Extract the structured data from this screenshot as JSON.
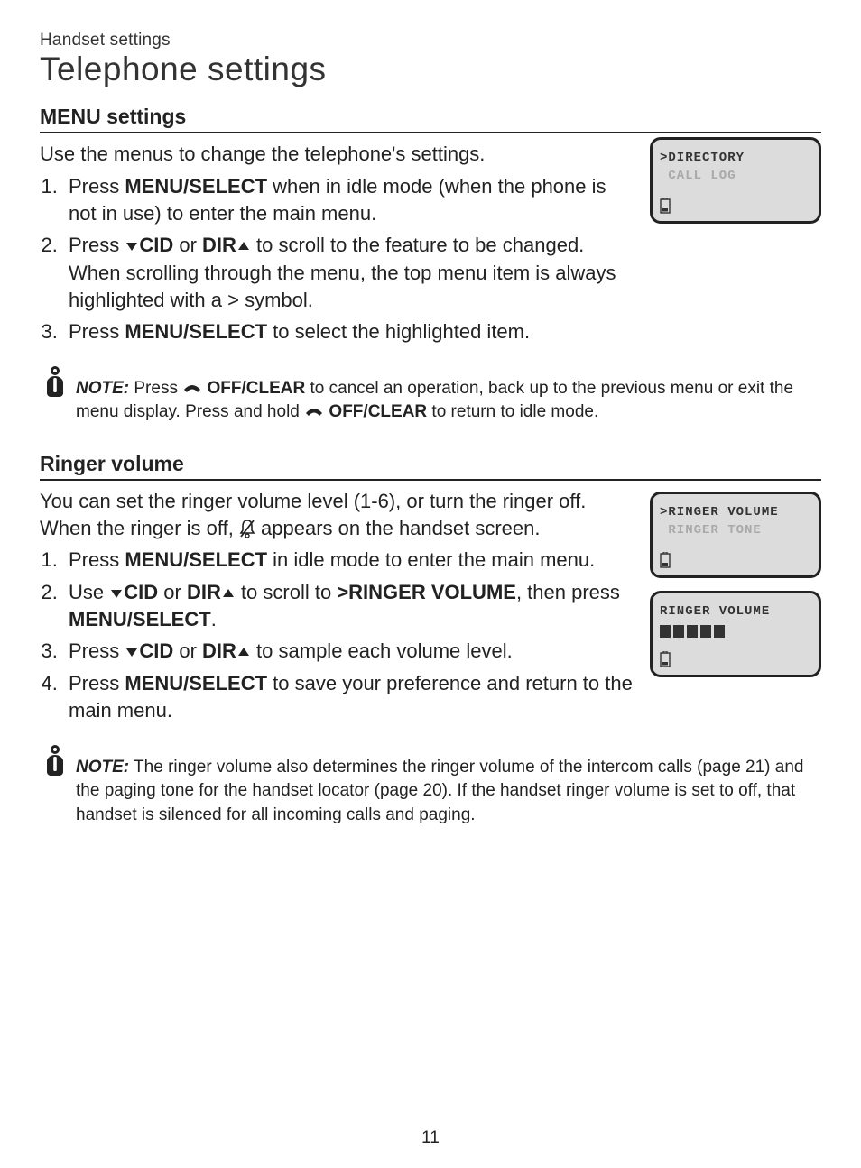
{
  "breadcrumb": "Handset settings",
  "page_title": "Telephone settings",
  "page_number": "11",
  "section1": {
    "heading": "MENU settings",
    "intro": "Use the menus to change the telephone's settings.",
    "step1_a": "Press ",
    "step1_b": "MENU/",
    "step1_c": "SELECT",
    "step1_d": " when in idle mode (when the phone is not in use) to enter the main menu.",
    "step2_a": "Press ",
    "step2_cid": "CID",
    "step2_or": " or ",
    "step2_dir": "DIR",
    "step2_b": " to scroll to the feature to be changed. When scrolling through the menu, the top menu item is always highlighted with a > symbol.",
    "step3_a": "Press ",
    "step3_menu": "MENU",
    "step3_select": "/SELECT",
    "step3_b": " to select the highlighted item.",
    "note_label": "NOTE:",
    "note_a": " Press ",
    "note_off1": " OFF/CLEAR",
    "note_b": " to cancel an operation, back up to the previous menu or exit the menu display. ",
    "note_hold": "Press and hold",
    "note_off2": " OFF/CLEAR",
    "note_c": " to return to idle mode."
  },
  "section2": {
    "heading": "Ringer volume",
    "intro_a": "You can set the ringer volume level (1-6), or turn the ringer off. When the ringer is off, ",
    "intro_b": " appears on the handset screen.",
    "step1_a": "Press ",
    "step1_b": "MENU/",
    "step1_c": "SELECT",
    "step1_d": " in idle mode to enter the main menu.",
    "step2_a": "Use ",
    "step2_cid": "CID",
    "step2_or": " or ",
    "step2_dir": "DIR",
    "step2_b": " to scroll to ",
    "step2_target": ">RINGER VOLUME",
    "step2_c": ", then press ",
    "step2_menu": "MENU",
    "step2_select": "/SELECT",
    "step2_d": ".",
    "step3_a": "Press ",
    "step3_cid": "CID",
    "step3_or": " or ",
    "step3_dir": "DIR",
    "step3_b": " to sample each volume level.",
    "step4_a": "Press ",
    "step4_menu": "MENU",
    "step4_select": "/SELECT",
    "step4_b": " to save your preference and return to the main menu.",
    "note_label": "NOTE:",
    "note_body": " The ringer volume also determines the ringer volume of the intercom calls (page 21) and the paging tone for the handset locator (page 20). If the handset ringer volume is set to off, that handset is silenced for all incoming calls and paging."
  },
  "screens": {
    "s1_line1": ">DIRECTORY",
    "s1_line2": " CALL LOG",
    "s2_line1": ">RINGER VOLUME",
    "s2_line2": " RINGER TONE",
    "s3_line1": "RINGER VOLUME",
    "s3_volume_level": 5
  }
}
